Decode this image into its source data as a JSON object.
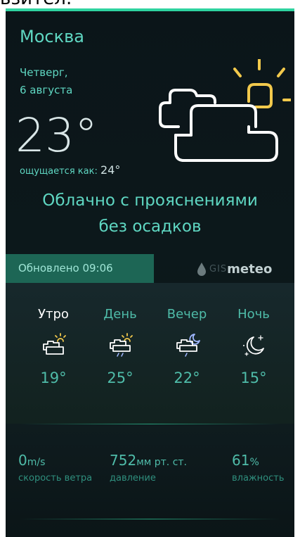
{
  "top_text": "ьзител:",
  "city": "Москва",
  "date": {
    "weekday": "Четверг,",
    "day": "6 августа"
  },
  "temperature": "23°",
  "feels_like": {
    "label": "ощущается как:",
    "value": "24°"
  },
  "condition": {
    "line1": "Облачно с прояснениями",
    "line2": "без осадков"
  },
  "updated": "Обновлено 09:06",
  "provider": {
    "prefix": "GIS",
    "name": "meteo"
  },
  "forecast": [
    {
      "name": "Утро",
      "temp": "19°",
      "icon": "partly-cloudy-icon",
      "active": true
    },
    {
      "name": "День",
      "temp": "25°",
      "icon": "sun-cloud-rain-icon",
      "active": false
    },
    {
      "name": "Вечер",
      "temp": "22°",
      "icon": "moon-cloud-rain-icon",
      "active": false
    },
    {
      "name": "Ночь",
      "temp": "15°",
      "icon": "moon-stars-icon",
      "active": false
    }
  ],
  "stats": {
    "wind": {
      "value": "0",
      "unit": "m/s",
      "label": "скорость ветра"
    },
    "pressure": {
      "value": "752",
      "unit": "мм рт. ст.",
      "label": "давление"
    },
    "humidity": {
      "value": "61",
      "unit": "%",
      "label": "влажность"
    }
  },
  "colors": {
    "accent": "#2fd3a0",
    "text_teal": "#5fd7c2",
    "sun": "#f2c94c",
    "updated_bg": "#1d6655"
  }
}
